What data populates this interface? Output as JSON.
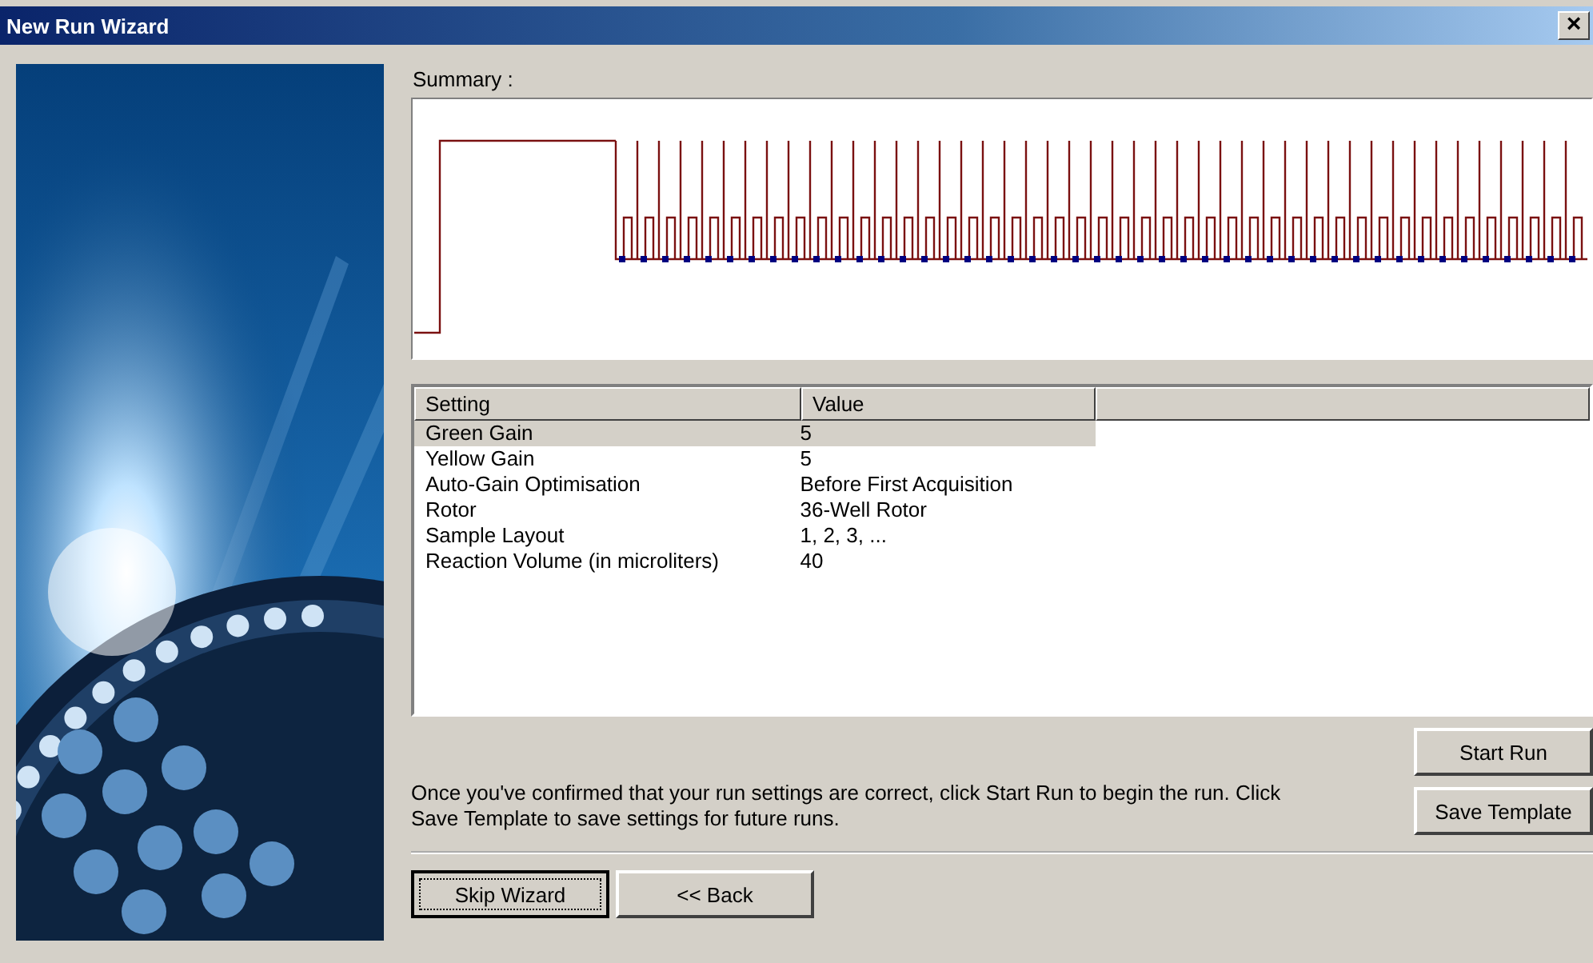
{
  "window": {
    "title": "New Run Wizard",
    "close": "×"
  },
  "summary": {
    "label": "Summary :"
  },
  "table": {
    "columns": [
      "Setting",
      "Value"
    ],
    "rows": [
      {
        "setting": "Green Gain",
        "value": "5",
        "selected": true
      },
      {
        "setting": "Yellow Gain",
        "value": "5",
        "selected": false
      },
      {
        "setting": "Auto-Gain Optimisation",
        "value": "Before First Acquisition",
        "selected": false
      },
      {
        "setting": "Rotor",
        "value": "36-Well Rotor",
        "selected": false
      },
      {
        "setting": "Sample Layout",
        "value": "1, 2, 3, ...",
        "selected": false
      },
      {
        "setting": "Reaction Volume (in microliters)",
        "value": "40",
        "selected": false
      }
    ]
  },
  "instructions": "Once you've confirmed that your run settings are correct, click Start Run to begin the run. Click Save Template to save settings for future runs.",
  "side_buttons": [
    "Start Run",
    "Save Template"
  ],
  "nav_buttons": [
    {
      "label": "Skip Wizard",
      "focused": true
    },
    {
      "label": "<< Back",
      "focused": false
    }
  ]
}
